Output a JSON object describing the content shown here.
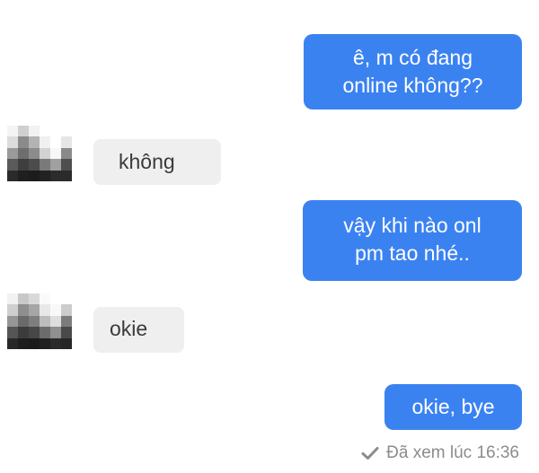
{
  "conversation": {
    "messages": [
      {
        "sender": "me",
        "lines": [
          "ê, m có đang",
          "online không??"
        ]
      },
      {
        "sender": "other",
        "lines": [
          "không"
        ]
      },
      {
        "sender": "me",
        "lines": [
          "vậy khi nào onl",
          "pm tao nhé.."
        ]
      },
      {
        "sender": "other",
        "lines": [
          "okie"
        ]
      },
      {
        "sender": "me",
        "lines": [
          "okie, bye"
        ]
      }
    ],
    "seen_status": "Đã xem lúc 16:36"
  },
  "colors": {
    "outgoing_bubble": "#3b82f1",
    "incoming_bubble": "#efeff0",
    "seen_text": "#8c8c8c"
  },
  "icons": {
    "seen": "checkmark-icon",
    "contact_avatar": "pixelated-avatar-icon"
  }
}
